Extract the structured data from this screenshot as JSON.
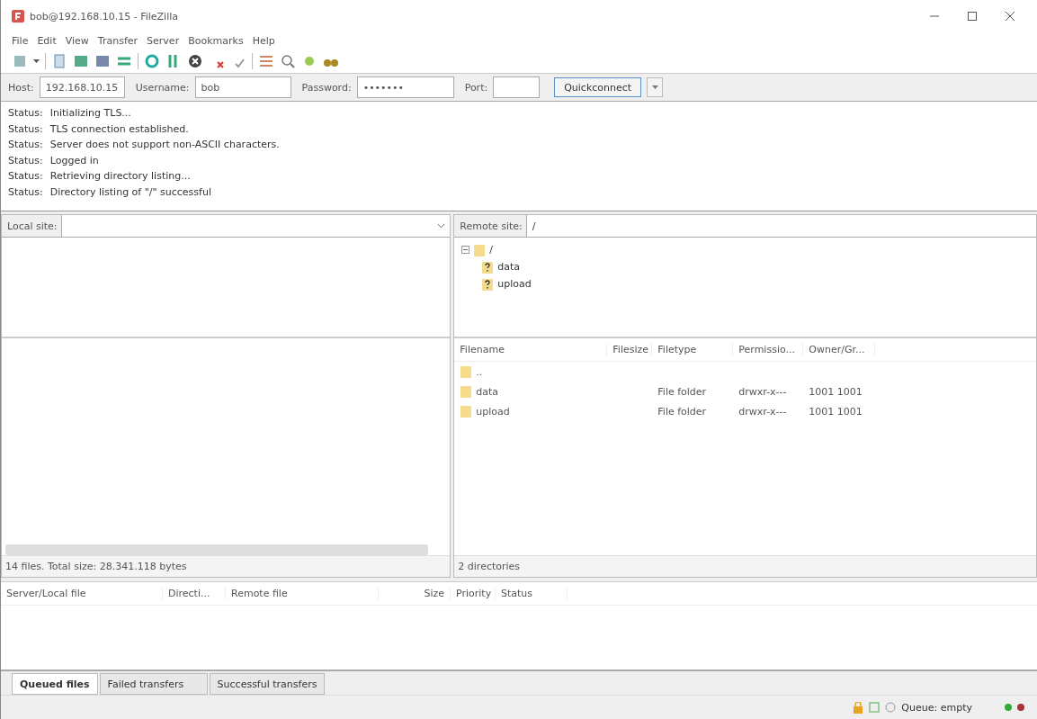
{
  "window": {
    "title": "bob@192.168.10.15 - FileZilla"
  },
  "menu": [
    "File",
    "Edit",
    "View",
    "Transfer",
    "Server",
    "Bookmarks",
    "Help"
  ],
  "quickconnect": {
    "host_label": "Host:",
    "host": "192.168.10.15",
    "username_label": "Username:",
    "username": "bob",
    "password_label": "Password:",
    "password": "•••••••",
    "port_label": "Port:",
    "button": "Quickconnect"
  },
  "log": [
    {
      "label": "Status:",
      "message": "Initializing TLS..."
    },
    {
      "label": "Status:",
      "message": "TLS connection established."
    },
    {
      "label": "Status:",
      "message": "Server does not support non-ASCII characters."
    },
    {
      "label": "Status:",
      "message": "Logged in"
    },
    {
      "label": "Status:",
      "message": "Retrieving directory listing..."
    },
    {
      "label": "Status:",
      "message": "Directory listing of \"/\" successful"
    }
  ],
  "local": {
    "site_label": "Local site:",
    "status": "14 files. Total size: 28.341.118 bytes"
  },
  "remote": {
    "site_label": "Remote site:",
    "path": "/",
    "tree": [
      {
        "name": "/",
        "kind": "folder",
        "expanded": true,
        "children": [
          {
            "name": "data",
            "kind": "unknown"
          },
          {
            "name": "upload",
            "kind": "unknown"
          }
        ]
      }
    ],
    "columns": [
      "Filename",
      "Filesize",
      "Filetype",
      "Permissio...",
      "Owner/Gr..."
    ],
    "rows": [
      {
        "name": "..",
        "type": "",
        "permissions": "",
        "owner": ""
      },
      {
        "name": "data",
        "type": "File folder",
        "permissions": "drwxr-x---",
        "owner": "1001 1001"
      },
      {
        "name": "upload",
        "type": "File folder",
        "permissions": "drwxr-x---",
        "owner": "1001 1001"
      }
    ],
    "status": "2 directories"
  },
  "queue": {
    "columns": [
      "Server/Local file",
      "Directi...",
      "Remote file",
      "Size",
      "Priority",
      "Status"
    ]
  },
  "tabs": [
    {
      "label": "Queued files",
      "selected": true
    },
    {
      "label": "Failed transfers",
      "selected": false
    },
    {
      "label": "Successful transfers",
      "selected": false
    }
  ],
  "status_bar": {
    "queue": "Queue: empty"
  }
}
